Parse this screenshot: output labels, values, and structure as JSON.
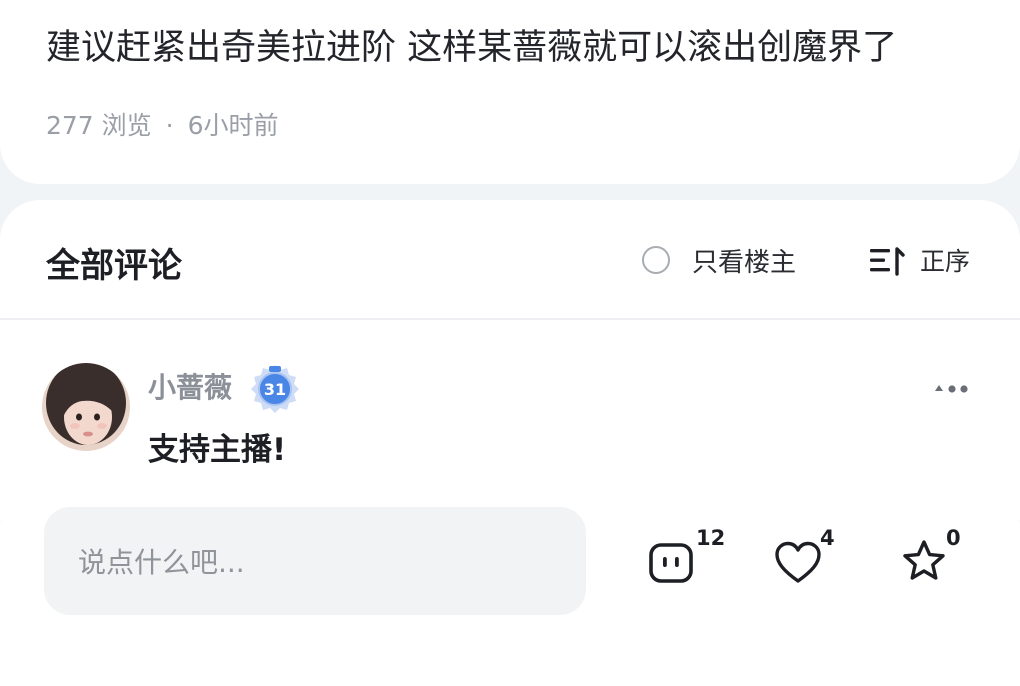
{
  "post": {
    "title": "建议赶紧出奇美拉进阶 这样某蔷薇就可以滚出创魔界了",
    "views": "277 浏览",
    "separator": "·",
    "time": "6小时前"
  },
  "comments": {
    "heading": "全部评论",
    "op_only_label": "只看楼主",
    "sort_label": "正序",
    "items": [
      {
        "username": "小蔷薇",
        "level": "31",
        "text": "支持主播!"
      }
    ]
  },
  "bottom_bar": {
    "input_placeholder": "说点什么吧...",
    "comment_count": "12",
    "like_count": "4",
    "favorite_count": "0"
  },
  "icons": {
    "sort": "sort-ascending-icon",
    "more": "more-dots-icon",
    "comment": "comment-icon",
    "like": "heart-icon",
    "favorite": "star-icon"
  },
  "colors": {
    "badge_blue": "#4a86e6",
    "muted_text": "#9a9ea6"
  }
}
